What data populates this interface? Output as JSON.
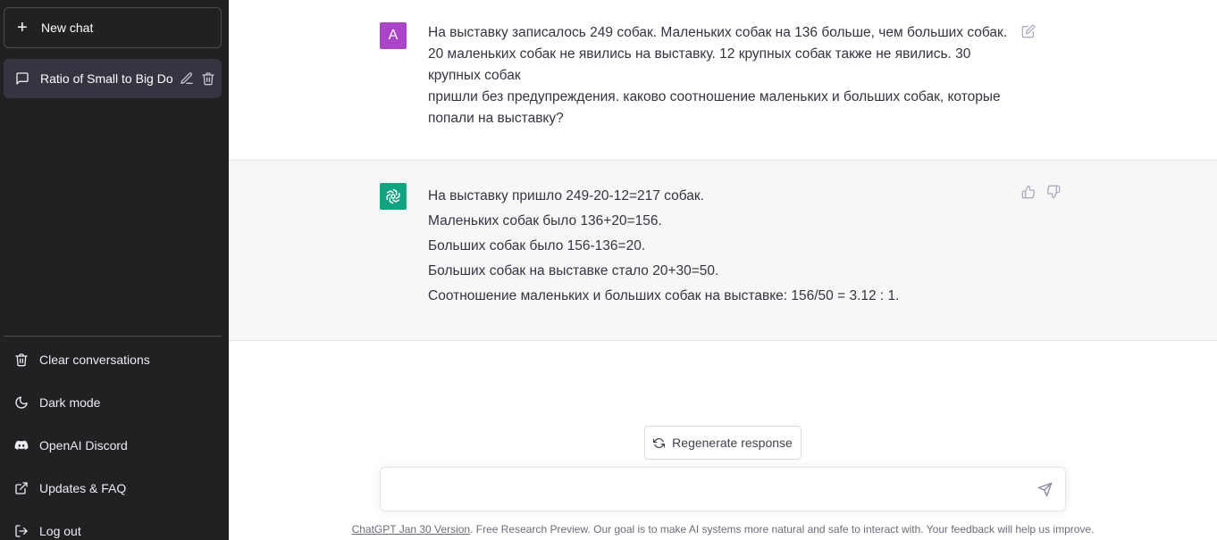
{
  "sidebar": {
    "new_chat": "New chat",
    "conversations": [
      {
        "title": "Ratio of Small to Big Do"
      }
    ],
    "menu": [
      {
        "label": "Clear conversations",
        "icon": "trash-icon"
      },
      {
        "label": "Dark mode",
        "icon": "moon-icon"
      },
      {
        "label": "OpenAI Discord",
        "icon": "discord-icon"
      },
      {
        "label": "Updates & FAQ",
        "icon": "external-link-icon"
      },
      {
        "label": "Log out",
        "icon": "logout-icon"
      }
    ]
  },
  "conversation": {
    "user_initial": "A",
    "user_lines": [
      "На выставку записалось 249 собак. Маленьких собак на 136 больше, чем больших собак. 20 маленьких собак не явились на выставку. 12 крупных собак также не явились. 30 крупных собак",
      "пришли без предупреждения. каково соотношение маленьких и больших собак, которые попали на выставку?"
    ],
    "assistant_lines": [
      "На выставку пришло 249-20-12=217 собак.",
      "Маленьких собак было 136+20=156.",
      "Больших собак было 156-136=20.",
      "Больших собак на выставке стало 20+30=50.",
      "Соотношение маленьких и больших собак на выставке: 156/50 = 3.12 : 1."
    ]
  },
  "composer": {
    "regenerate": "Regenerate response",
    "placeholder": ""
  },
  "footer": {
    "version_link": "ChatGPT Jan 30 Version",
    "text": ". Free Research Preview. Our goal is to make AI systems more natural and safe to interact with. Your feedback will help us improve."
  },
  "colors": {
    "sidebar_bg": "#202123",
    "active_item_bg": "#343541",
    "user_avatar": "#ab45c8",
    "assistant_avatar": "#10a37f",
    "assistant_row_bg": "#f7f7f8"
  }
}
